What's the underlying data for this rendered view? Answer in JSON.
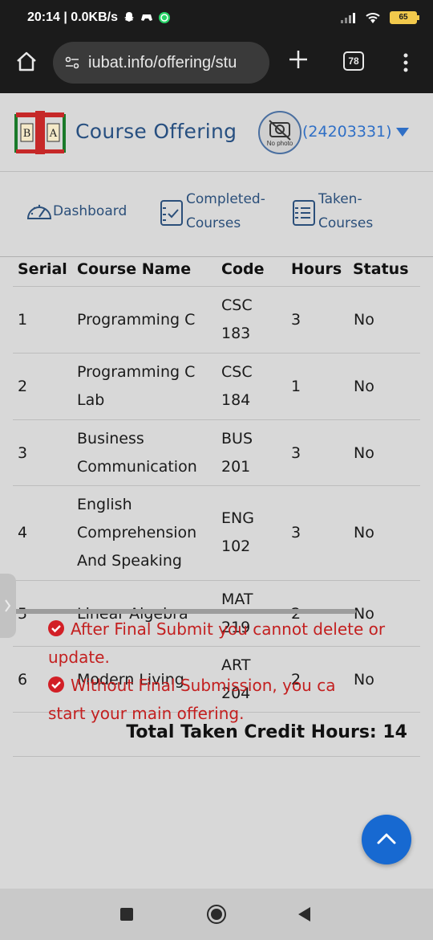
{
  "status_bar": {
    "time_speed": "20:14 | 0.0KB/s",
    "battery": "65"
  },
  "browser": {
    "url": "iubat.info/offering/stu",
    "tab_count": "78"
  },
  "header": {
    "title": "Course Offering",
    "avatar_caption": "No photo",
    "student_id": "(24203331)"
  },
  "nav": {
    "dashboard": "Dashboard",
    "completed_line1": "Completed-",
    "completed_line2": "Courses",
    "taken_line1": "Taken-",
    "taken_line2": "Courses"
  },
  "table": {
    "headers": {
      "serial": "Serial",
      "course_name": "Course Name",
      "code": "Code",
      "hours": "Hours",
      "status": "Status"
    },
    "rows": [
      {
        "serial": "1",
        "name": [
          "Programming C"
        ],
        "code": [
          "CSC",
          "183"
        ],
        "hours": "3",
        "status": "No"
      },
      {
        "serial": "2",
        "name": [
          "Programming C",
          "Lab"
        ],
        "code": [
          "CSC",
          "184"
        ],
        "hours": "1",
        "status": "No"
      },
      {
        "serial": "3",
        "name": [
          "Business",
          "Communication"
        ],
        "code": [
          "BUS",
          "201"
        ],
        "hours": "3",
        "status": "No"
      },
      {
        "serial": "4",
        "name": [
          "English",
          "Comprehension",
          "And Speaking"
        ],
        "code": [
          "ENG",
          "102"
        ],
        "hours": "3",
        "status": "No"
      },
      {
        "serial": "5",
        "name": [
          "Linear Algebra"
        ],
        "code": [
          "MAT",
          "219"
        ],
        "hours": "2",
        "status": "No"
      },
      {
        "serial": "6",
        "name": [
          "Modern Living"
        ],
        "code": [
          "ART",
          "204"
        ],
        "hours": "2",
        "status": "No"
      }
    ],
    "total_label": "Total Taken Credit Hours: 14"
  },
  "notes": {
    "note1_line1": "After Final Submit you cannot delete or",
    "note1_line2": "update.",
    "note2_line1": "Without Final Submission, you ca",
    "note2_line2": "start your main offering."
  },
  "colors": {
    "title_blue": "#274f80",
    "link_blue": "#2f6fc6",
    "warning_red": "#c31f1f",
    "fab_blue": "#1769d1"
  }
}
